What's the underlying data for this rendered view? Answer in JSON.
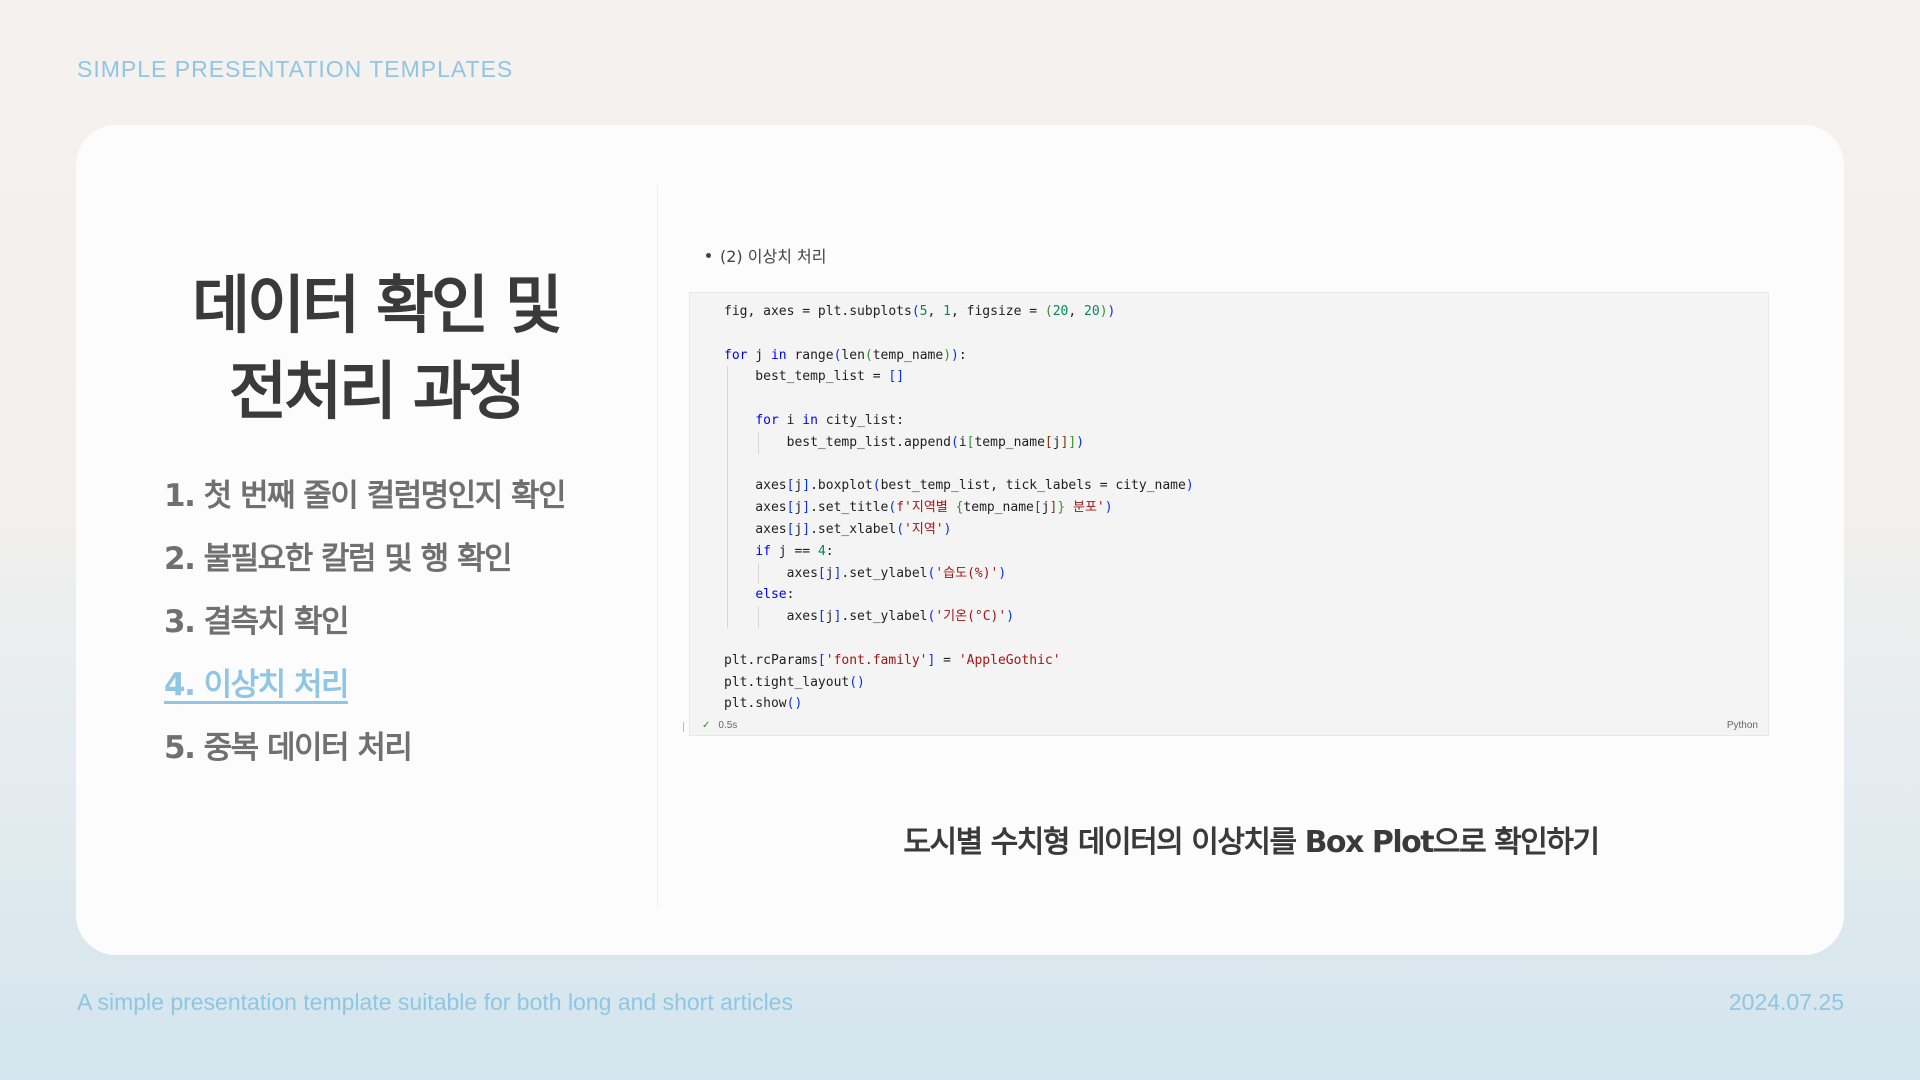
{
  "header": {
    "brand": "SIMPLE PRESENTATION TEMPLATES"
  },
  "slide": {
    "title_line1": "데이터 확인 및",
    "title_line2": "전처리 과정",
    "toc": [
      {
        "label": "1. 첫 번째 줄이 컬럼명인지 확인",
        "active": false
      },
      {
        "label": "2. 불필요한 칼럼 및 행 확인",
        "active": false
      },
      {
        "label": "3. 결측치 확인",
        "active": false
      },
      {
        "label": "4. 이상치 처리",
        "active": true
      },
      {
        "label": "5. 중복 데이터 처리",
        "active": false
      }
    ],
    "bullet_caption": "(2) 이상치 처리",
    "code_cell": {
      "exec_time": "0.5s",
      "language": "Python"
    },
    "code_caption": "도시별 수치형 데이터의 이상치를 Box Plot으로 확인하기"
  },
  "footer": {
    "text": "A simple presentation template suitable for both long and short articles",
    "date": "2024.07.25"
  }
}
